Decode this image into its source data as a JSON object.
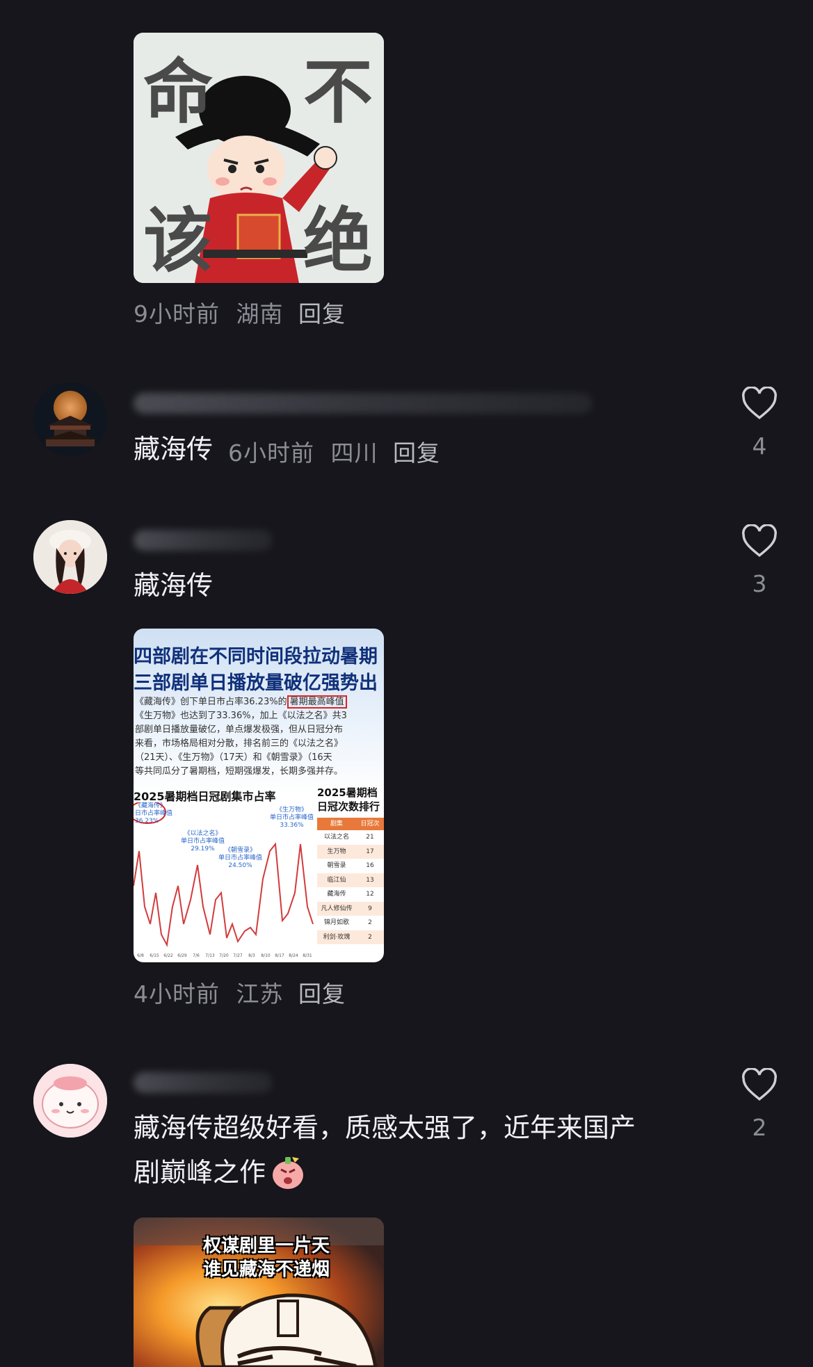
{
  "comments": [
    {
      "meta": {
        "time": "9小时前",
        "location": "湖南",
        "reply": "回复"
      },
      "sticker": {
        "chars": [
          "命",
          "不",
          "该",
          "绝"
        ]
      }
    },
    {
      "text": "藏海传",
      "meta": {
        "time": "6小时前",
        "location": "四川",
        "reply": "回复"
      },
      "likes": "4"
    },
    {
      "text": "藏海传",
      "likes": "3",
      "infographic": {
        "title1": "四部剧在不同时间段拉动暑期",
        "title2": "三部剧单日播放量破亿强势出",
        "para": [
          "《藏海传》创下单日市占率36.23%的",
          "暑期最高峰值",
          "《生万物》也达到了33.36%，加上《以法之名》共3",
          "部剧单日播放量破亿，单点爆发极强，但从日冠分布",
          "来看，市场格局相对分散，排名前三的《以法之名》",
          "（21天）、《生万物》（17天）和《朝雪录》（16天",
          "等共同瓜分了暑期档，短期强爆发，长期多强并存。"
        ],
        "chart_title": "2025暑期档日冠剧集市占率",
        "rank_title1": "2025暑期档",
        "rank_title2": "日冠次数排行",
        "rank_headers": [
          "剧集",
          "日冠次"
        ],
        "callouts": [
          {
            "name": "《藏海传》",
            "label": "日市占率峰值",
            "value": "36.23%"
          },
          {
            "name": "《以法之名》",
            "label": "单日市占率峰值",
            "value": "29.19%"
          },
          {
            "name": "《朝雪录》",
            "label": "单日市占率峰值",
            "value": "24.50%"
          },
          {
            "name": "《生万物》",
            "label": "单日市占率峰值",
            "value": "33.36%"
          }
        ],
        "x_ticks": [
          "6/8",
          "6/15",
          "6/22",
          "6/29",
          "7/6",
          "7/13",
          "7/20",
          "7/27",
          "8/3",
          "8/10",
          "8/17",
          "8/24",
          "8/31"
        ],
        "rank": [
          {
            "name": "以法之名",
            "days": "21"
          },
          {
            "name": "生万物",
            "days": "17"
          },
          {
            "name": "朝雪录",
            "days": "16"
          },
          {
            "name": "临江仙",
            "days": "13"
          },
          {
            "name": "藏海传",
            "days": "12"
          },
          {
            "name": "凡人修仙传",
            "days": "9"
          },
          {
            "name": "锦月如歌",
            "days": "2"
          },
          {
            "name": "利剑·玫瑰",
            "days": "2"
          }
        ]
      },
      "meta": {
        "time": "4小时前",
        "location": "江苏",
        "reply": "回复"
      }
    },
    {
      "text_line1": "藏海传超级好看，质感太强了，近年来国产",
      "text_line2": "剧巅峰之作",
      "likes": "2",
      "meme": {
        "line1": "权谋剧里一片天",
        "line2": "谁见藏海不递烟"
      }
    }
  ],
  "colors": {
    "background": "#16161c",
    "meta_text": "#8d8d96",
    "primary_text": "#f1f1f5"
  }
}
